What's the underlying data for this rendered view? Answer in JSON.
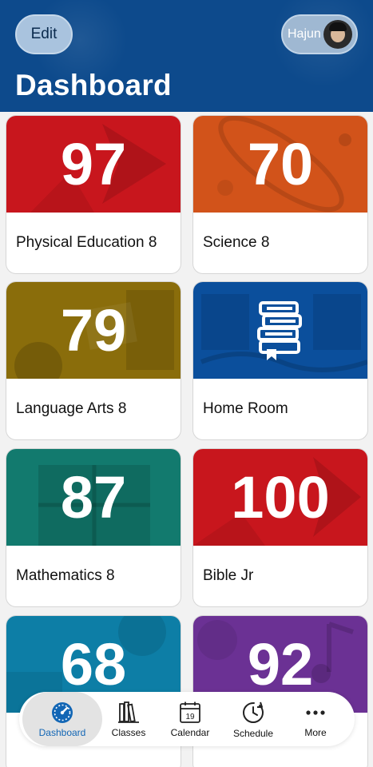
{
  "header": {
    "edit_label": "Edit",
    "user_name": "Hajun",
    "title": "Dashboard",
    "color": "#0d4a8c"
  },
  "cards": [
    {
      "grade": "97",
      "name": "Physical Education 8",
      "color": "#c8161d"
    },
    {
      "grade": "70",
      "name": "Science 8",
      "color": "#d2531a"
    },
    {
      "grade": "79",
      "name": "Language Arts 8",
      "color": "#8a6d0b"
    },
    {
      "grade": "",
      "name": "Home Room",
      "color": "#0b4f9c",
      "icon": "books-icon"
    },
    {
      "grade": "87",
      "name": "Mathematics 8",
      "color": "#127a6e"
    },
    {
      "grade": "100",
      "name": "Bible Jr",
      "color": "#c8161d"
    },
    {
      "grade": "68",
      "name": "",
      "color": "#0d7ea6"
    },
    {
      "grade": "92",
      "name": "",
      "color": "#6b3194"
    }
  ],
  "tabbar": {
    "active_color": "#1266b5",
    "tabs": [
      {
        "label": "Dashboard",
        "icon": "gauge-icon"
      },
      {
        "label": "Classes",
        "icon": "books-icon"
      },
      {
        "label": "Calendar",
        "icon": "calendar-icon",
        "day": "19"
      },
      {
        "label": "Schedule",
        "icon": "clock-icon"
      },
      {
        "label": "More",
        "icon": "more-icon"
      }
    ]
  }
}
